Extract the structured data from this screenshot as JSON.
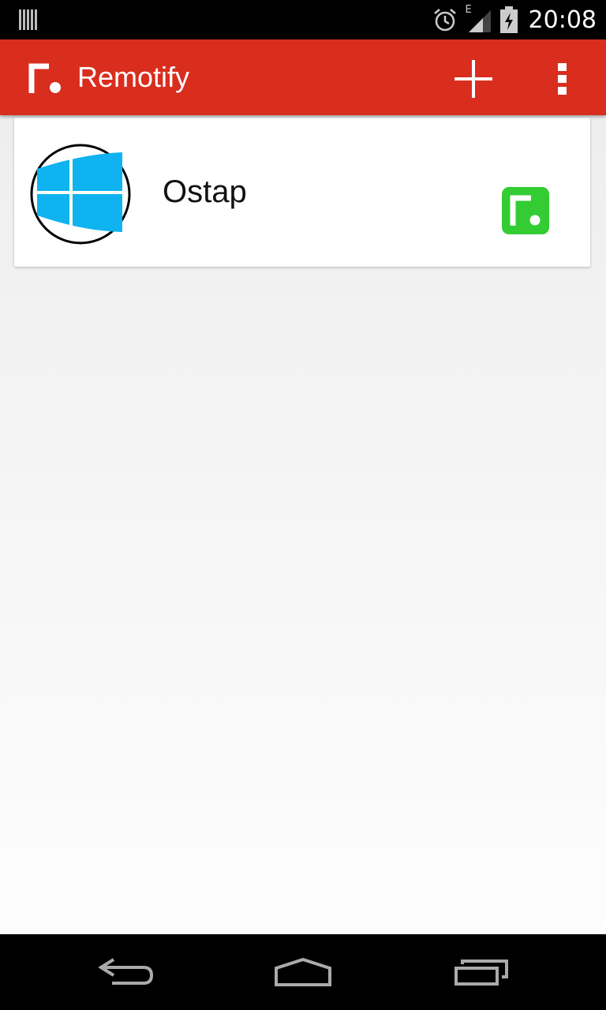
{
  "status_bar": {
    "time": "20:08",
    "network_type": "E",
    "icons": [
      "notification-bars-icon",
      "alarm-icon",
      "signal-icon",
      "battery-charging-icon"
    ]
  },
  "app_bar": {
    "title": "Remotify",
    "logo_icon": "remotify-logo-icon",
    "actions": [
      "add-icon",
      "more-vert-icon"
    ]
  },
  "devices": [
    {
      "name": "Ostap",
      "os_icon": "windows-icon",
      "status_icon": "remotify-connected-icon",
      "status_color": "#33cc33"
    }
  ],
  "colors": {
    "app_bar": "#d92d1e",
    "windows_blue": "#0eb3f0",
    "status_green": "#33cc33"
  },
  "nav_bar": {
    "buttons": [
      "back-icon",
      "home-icon",
      "recents-icon"
    ]
  }
}
